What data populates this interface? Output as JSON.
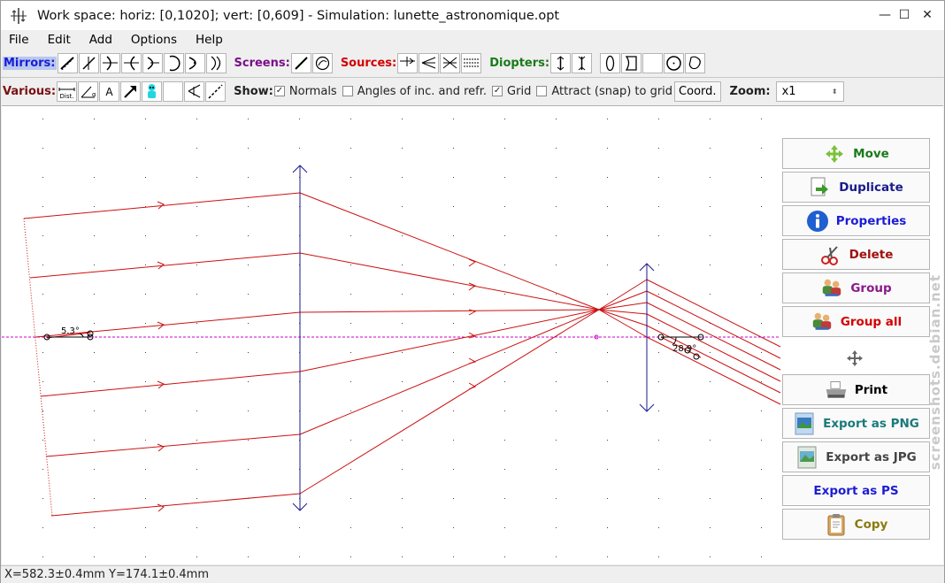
{
  "window": {
    "title": "Work space: horiz: [0,1020]; vert: [0,609]  - Simulation: lunette_astronomique.opt",
    "minimize_glyph": "—",
    "maximize_glyph": "☐",
    "close_glyph": "✕"
  },
  "menu": [
    "File",
    "Edit",
    "Add",
    "Options",
    "Help"
  ],
  "toolbar1": {
    "mirrors_label": "Mirrors:",
    "screens_label": "Screens:",
    "sources_label": "Sources:",
    "diopters_label": "Diopters:",
    "colors": {
      "mirrors": "#1c1cd6",
      "screens": "#7a0f8a",
      "sources": "#d40000",
      "diopters": "#1a7a1a"
    }
  },
  "toolbar2": {
    "various_label": "Various:",
    "various_color": "#7a1010",
    "show_label": "Show:",
    "normals": {
      "label": "Normals",
      "checked": true
    },
    "angles": {
      "label": "Angles of inc. and refr.",
      "checked": false
    },
    "grid": {
      "label": "Grid",
      "checked": true
    },
    "snap": {
      "label": "Attract (snap) to grid",
      "checked": false
    },
    "coord_button": "Coord.",
    "zoom_label": "Zoom:",
    "zoom_value": "x1",
    "check_glyph": "✓"
  },
  "canvas": {
    "angle_label_left": "5.3°",
    "angle_label_right": "28.9°",
    "ray_color": "#cc1010",
    "lens_color": "#1a1a8c",
    "axis_color": "#cc00cc"
  },
  "side_buttons": {
    "move": {
      "label": "Move",
      "color": "#1a7a1a"
    },
    "duplicate": {
      "label": "Duplicate",
      "color": "#1a1a8c"
    },
    "properties": {
      "label": "Properties",
      "color": "#1c1cd6"
    },
    "delete": {
      "label": "Delete",
      "color": "#a01010"
    },
    "group": {
      "label": "Group",
      "color": "#8a1a8a"
    },
    "group_all": {
      "label": "Group all",
      "color": "#d40000"
    },
    "print": {
      "label": "Print",
      "color": "#000000"
    },
    "export_png": {
      "label": "Export as PNG",
      "color": "#1a7a7a"
    },
    "export_jpg": {
      "label": "Export as JPG",
      "color": "#444444"
    },
    "export_ps": {
      "label": "Export as PS",
      "color": "#1c1cd6"
    },
    "copy": {
      "label": "Copy",
      "color": "#8a7a10"
    }
  },
  "watermark": "screenshots.debian.net",
  "status": "X=582.3±0.4mm  Y=174.1±0.4mm"
}
